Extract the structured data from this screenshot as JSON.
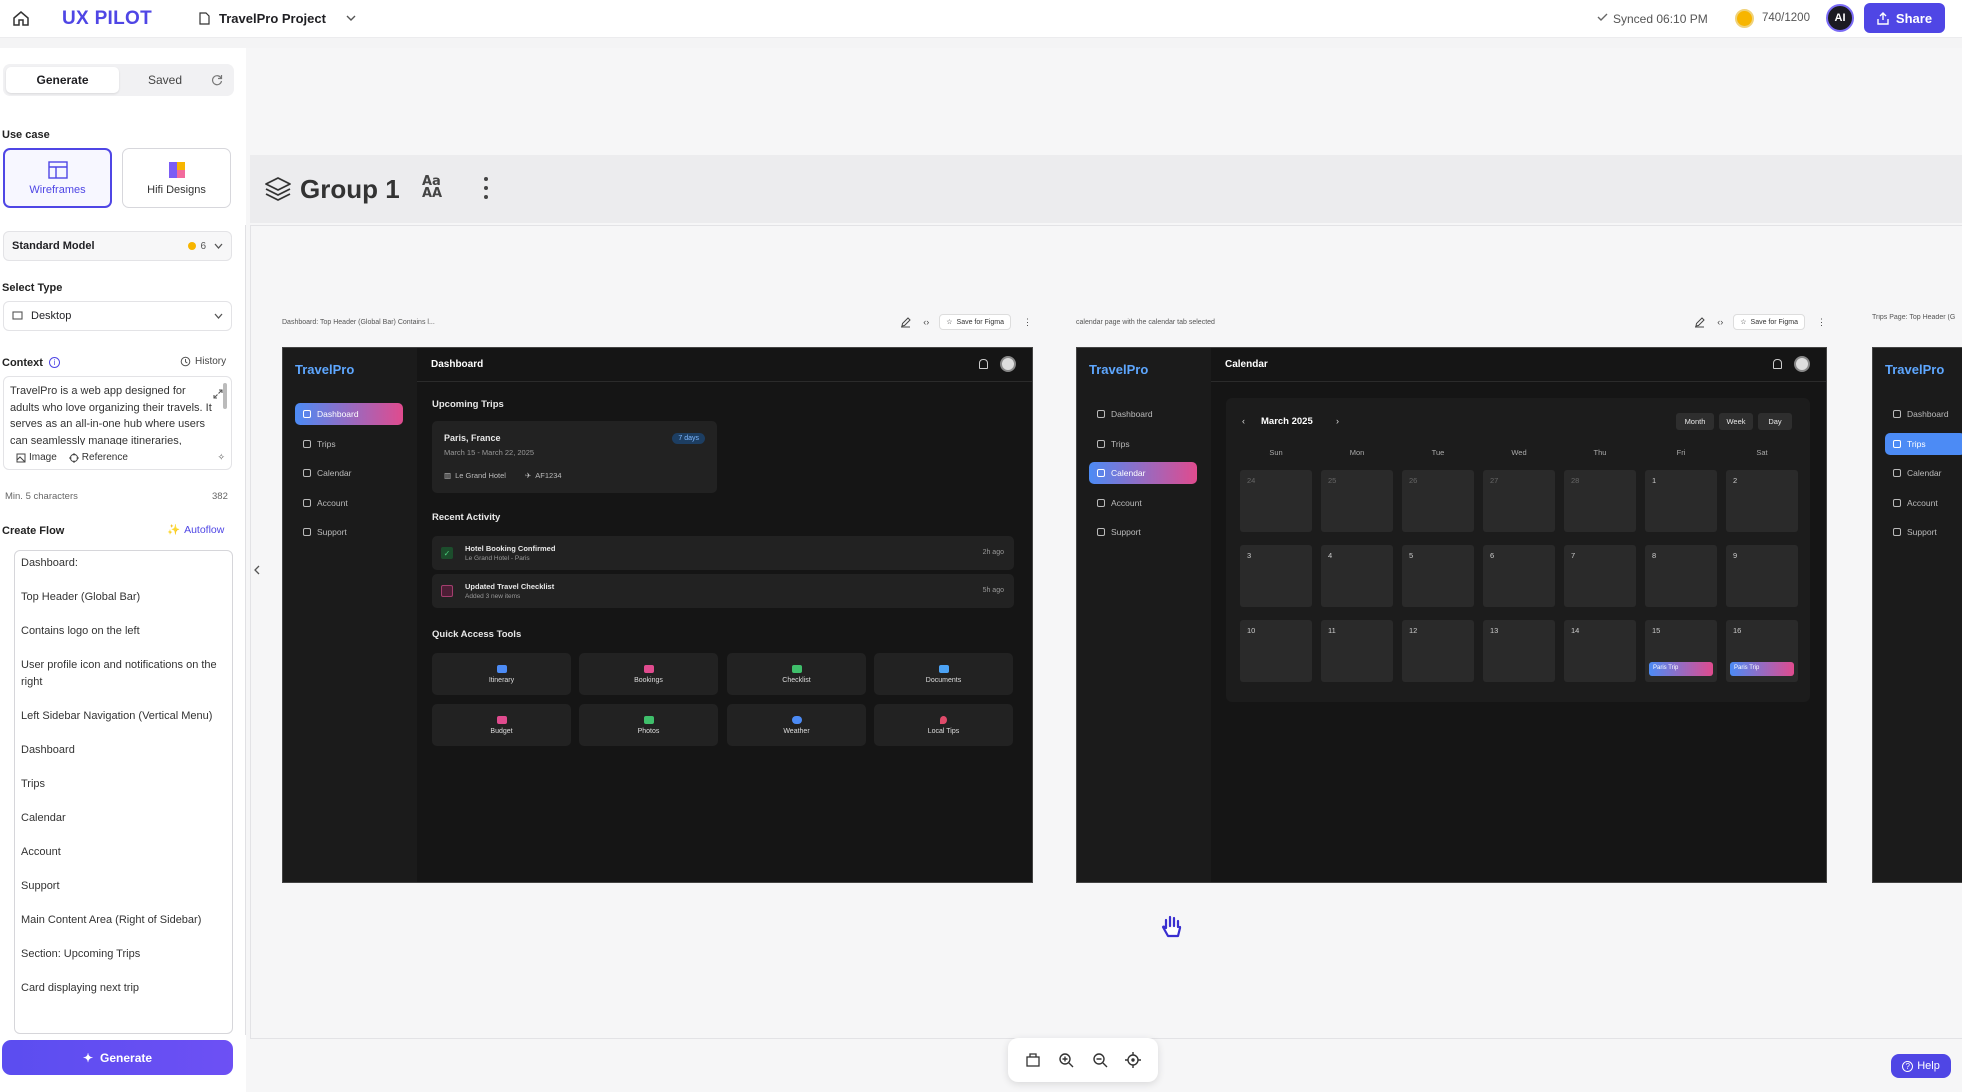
{
  "topbar": {
    "brand": "UX PILOT",
    "project": "TravelPro Project",
    "sync_status": "Synced 06:10 PM",
    "credits": "740/1200",
    "avatar_initials": "AI",
    "share_label": "Share",
    "accent": "#4f46e5"
  },
  "sidebar": {
    "tabs": [
      "Generate",
      "Saved"
    ],
    "use_case_label": "Use case",
    "use_cases": [
      "Wireframes",
      "Hifi Designs"
    ],
    "model": {
      "name": "Standard Model",
      "cost": "6"
    },
    "select_type_label": "Select Type",
    "select_type_value": "Desktop",
    "context_label": "Context",
    "history_label": "History",
    "context_text": "TravelPro is a web app designed for adults who love organizing their travels. It serves as an all-in-one hub where users can seamlessly manage itineraries, bookings, checklists",
    "image_label": "Image",
    "reference_label": "Reference",
    "min_chars": "Min. 5 characters",
    "char_count": "382",
    "create_flow_label": "Create Flow",
    "autoflow_label": "Autoflow",
    "flow_items": [
      "Dashboard:",
      "Top Header (Global Bar)",
      "Contains logo on the left",
      "User profile icon and notifications on the right",
      "Left Sidebar Navigation (Vertical Menu)",
      "Dashboard",
      "Trips",
      "Calendar",
      "Account",
      "Support",
      "Main Content Area (Right of Sidebar)",
      "Section: Upcoming Trips",
      "Card displaying next trip"
    ],
    "generate_label": "Generate"
  },
  "canvas": {
    "group_title": "Group 1",
    "frames": [
      {
        "caption": "Dashboard: Top Header (Global Bar) Contains l...",
        "save_label": "Save for Figma"
      },
      {
        "caption": "calendar page with the calendar tab selected",
        "save_label": "Save for Figma"
      },
      {
        "caption": "Trips Page: Top Header (G"
      }
    ],
    "help_label": "Help"
  },
  "dashboard": {
    "brand": "TravelPro",
    "title": "Dashboard",
    "nav": [
      "Dashboard",
      "Trips",
      "Calendar",
      "Account",
      "Support"
    ],
    "upcoming_title": "Upcoming Trips",
    "trip": {
      "name": "Paris, France",
      "dates": "March 15 - March 22, 2025",
      "badge": "7 days",
      "hotel": "Le Grand Hotel",
      "flight": "AF1234"
    },
    "activity_title": "Recent Activity",
    "activities": [
      {
        "title": "Hotel Booking Confirmed",
        "sub": "Le Grand Hotel - Paris",
        "time": "2h ago"
      },
      {
        "title": "Updated Travel Checklist",
        "sub": "Added 3 new items",
        "time": "5h ago"
      }
    ],
    "tools_title": "Quick Access Tools",
    "tools": [
      "Itinerary",
      "Bookings",
      "Checklist",
      "Documents",
      "Budget",
      "Photos",
      "Weather",
      "Local Tips"
    ]
  },
  "calendar": {
    "brand": "TravelPro",
    "title": "Calendar",
    "nav": [
      "Dashboard",
      "Trips",
      "Calendar",
      "Account",
      "Support"
    ],
    "month": "March 2025",
    "views": [
      "Month",
      "Week",
      "Day"
    ],
    "weekdays": [
      "Sun",
      "Mon",
      "Tue",
      "Wed",
      "Thu",
      "Fri",
      "Sat"
    ],
    "rows": [
      [
        "24",
        "25",
        "26",
        "27",
        "28",
        "1",
        "2"
      ],
      [
        "3",
        "4",
        "5",
        "6",
        "7",
        "8",
        "9"
      ],
      [
        "10",
        "11",
        "12",
        "13",
        "14",
        "15",
        "16"
      ]
    ],
    "event_label": "Paris Trip"
  },
  "trips": {
    "brand": "TravelPro",
    "nav": [
      "Dashboard",
      "Trips",
      "Calendar",
      "Account",
      "Support"
    ]
  }
}
